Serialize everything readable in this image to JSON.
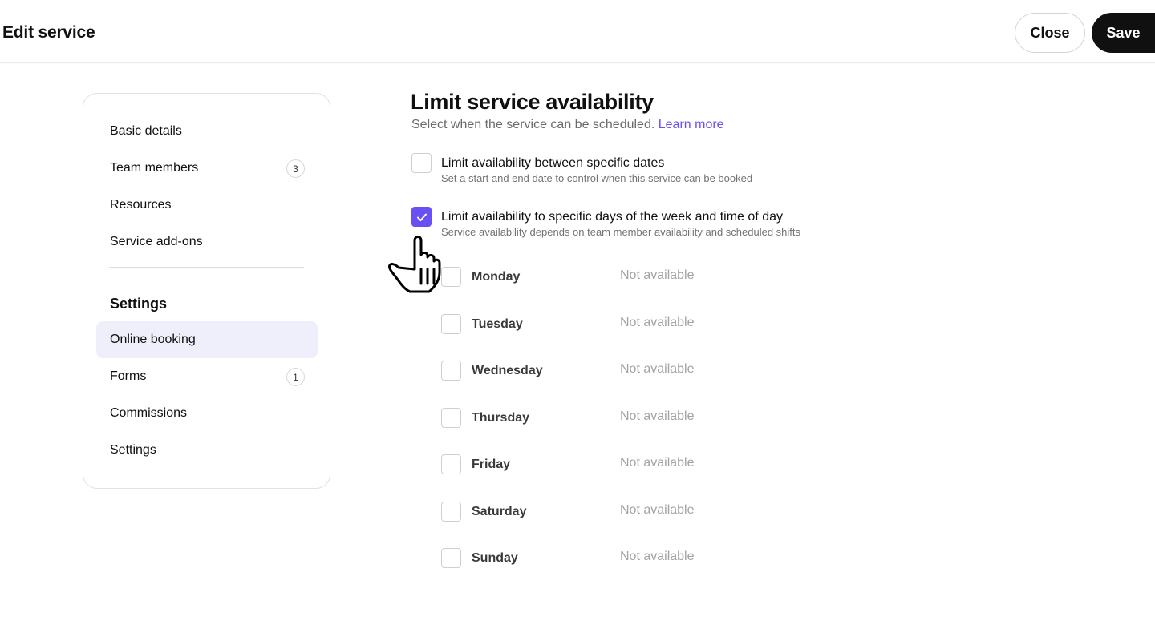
{
  "header": {
    "title": "Edit service",
    "close_label": "Close",
    "save_label": "Save"
  },
  "sidebar": {
    "items": [
      {
        "label": "Basic details"
      },
      {
        "label": "Team members",
        "badge": "3"
      },
      {
        "label": "Resources"
      },
      {
        "label": "Service add-ons"
      }
    ],
    "section_title": "Settings",
    "settings_items": [
      {
        "label": "Online booking",
        "active": true
      },
      {
        "label": "Forms",
        "badge": "1"
      },
      {
        "label": "Commissions"
      },
      {
        "label": "Settings"
      }
    ]
  },
  "main": {
    "title": "Limit service availability",
    "subtitle": "Select when the service can be scheduled.",
    "learn_more": "Learn more",
    "options": [
      {
        "label": "Limit availability between specific dates",
        "help": "Set a start and end date to control when this service can be booked",
        "checked": false
      },
      {
        "label": "Limit availability to specific days of the week and time of day",
        "help": "Service availability depends on team member availability and scheduled shifts",
        "checked": true
      }
    ],
    "days": [
      {
        "name": "Monday",
        "status": "Not available",
        "checked": false
      },
      {
        "name": "Tuesday",
        "status": "Not available",
        "checked": false
      },
      {
        "name": "Wednesday",
        "status": "Not available",
        "checked": false
      },
      {
        "name": "Thursday",
        "status": "Not available",
        "checked": false
      },
      {
        "name": "Friday",
        "status": "Not available",
        "checked": false
      },
      {
        "name": "Saturday",
        "status": "Not available",
        "checked": false
      },
      {
        "name": "Sunday",
        "status": "Not available",
        "checked": false
      }
    ]
  },
  "colors": {
    "accent": "#6950f3",
    "active_nav_bg": "#efeffb",
    "primary_button": "#101010"
  },
  "icons": {
    "checkbox_checked": "check-icon",
    "pointer": "hand-pointer-icon"
  }
}
